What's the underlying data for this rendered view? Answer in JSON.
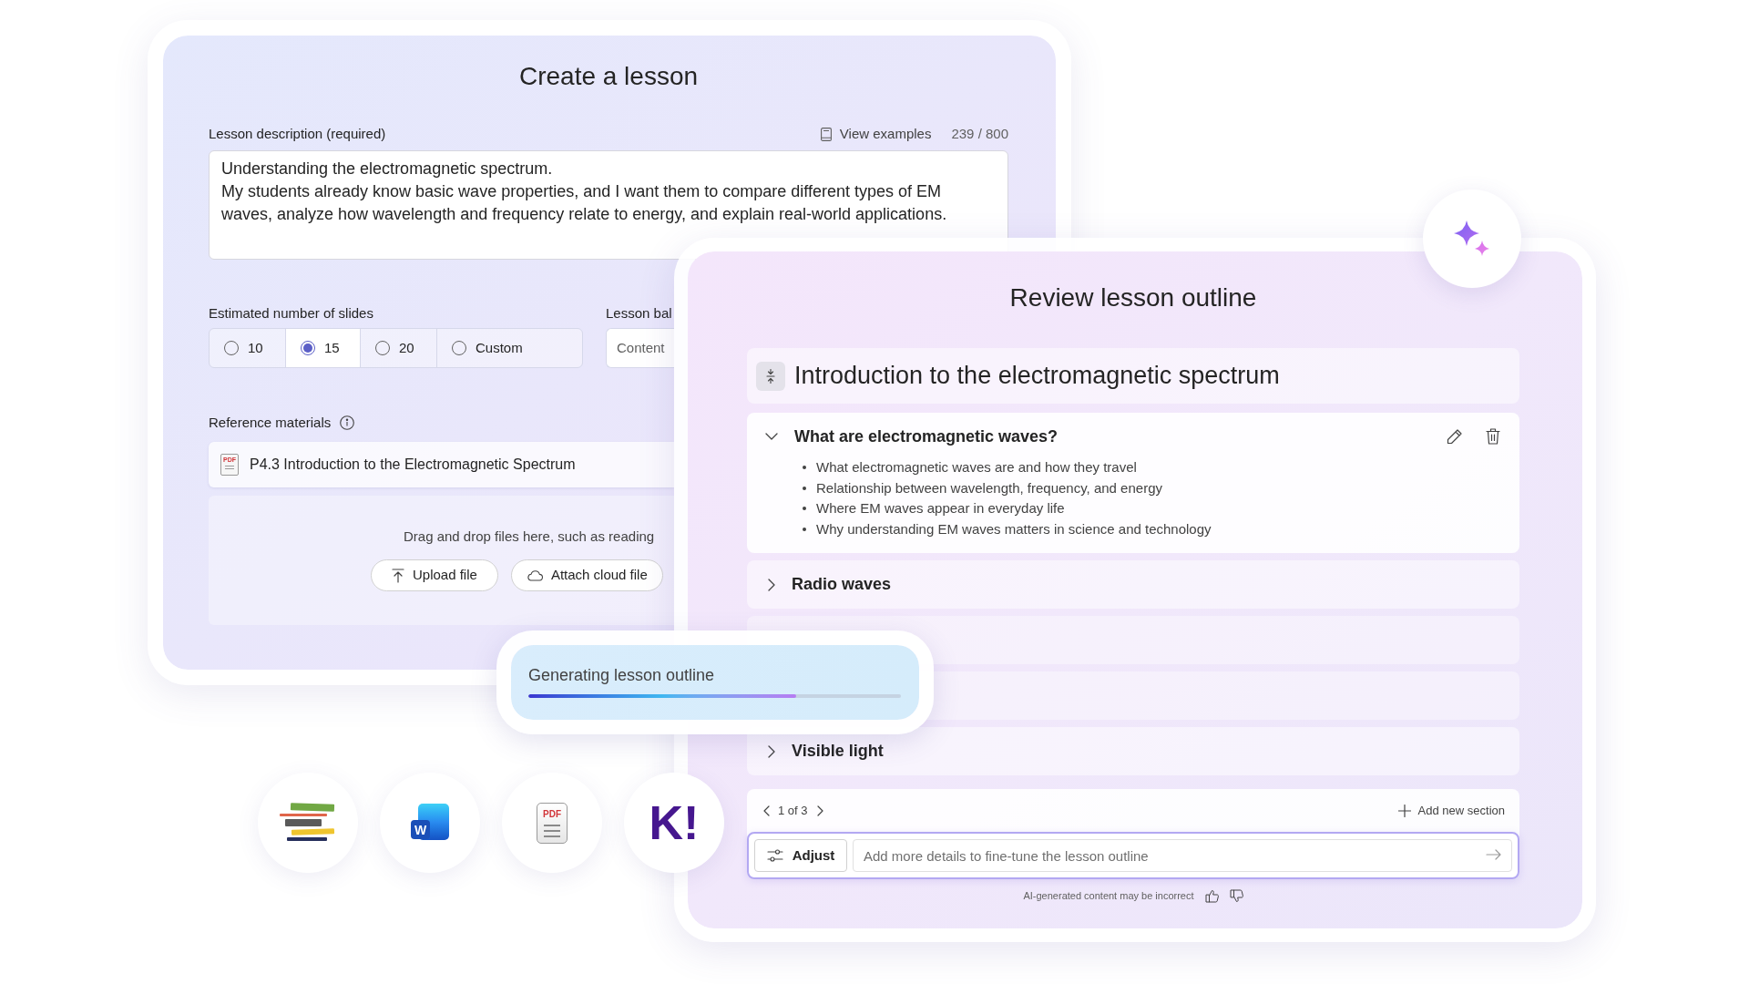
{
  "lesson_form": {
    "title": "Create a lesson",
    "description": {
      "label": "Lesson description (required)",
      "examples_link": "View examples",
      "counter": "239 / 800",
      "value": "Understanding the electromagnetic spectrum.\nMy students already know basic wave properties, and I want them to compare different types of EM waves, analyze how wavelength and frequency relate to energy, and explain real-world applications."
    },
    "slides": {
      "label": "Estimated number of slides",
      "options": [
        {
          "label": "10",
          "selected": false
        },
        {
          "label": "15",
          "selected": true
        },
        {
          "label": "20",
          "selected": false
        },
        {
          "label": "Custom",
          "selected": false
        }
      ]
    },
    "balance": {
      "label": "Lesson bal",
      "value": "Content"
    },
    "reference": {
      "label": "Reference materials",
      "files": [
        {
          "icon_text": "PDF",
          "name": "P4.3 Introduction to the Electromagnetic Spectrum"
        }
      ],
      "drop_hint": "Drag and drop files here, such as reading",
      "buttons": [
        {
          "kind": "upload",
          "label": "Upload file"
        },
        {
          "kind": "cloud",
          "label": "Attach cloud file"
        }
      ]
    }
  },
  "outline": {
    "title": "Review lesson outline",
    "heading": "Introduction to the electromagnetic spectrum",
    "sections": [
      {
        "kind": "section",
        "title": "What are electromagnetic waves?",
        "expanded": true,
        "points": [
          "What electromagnetic waves are and how they travel",
          "Relationship between wavelength, frequency, and energy",
          "Where EM waves appear in everyday life",
          "Why understanding EM waves matters in science and technology"
        ]
      },
      {
        "kind": "section",
        "title": "Radio waves",
        "expanded": false
      },
      {
        "kind": "blank"
      },
      {
        "kind": "blank"
      },
      {
        "kind": "section",
        "title": "Visible light",
        "expanded": false
      }
    ],
    "pager": "1 of 3",
    "add_section": "Add new section",
    "adjust": "Adjust",
    "prompt": {
      "placeholder": "Add more details to fine-tune the lesson outline"
    },
    "disclaimer": "AI-generated content may be incorrect"
  },
  "progress": {
    "label": "Generating lesson outline",
    "level": 0.72
  },
  "app_icons": {
    "document_letter": "W",
    "pdf_label": "PDF",
    "quiz_logo": "K!"
  }
}
